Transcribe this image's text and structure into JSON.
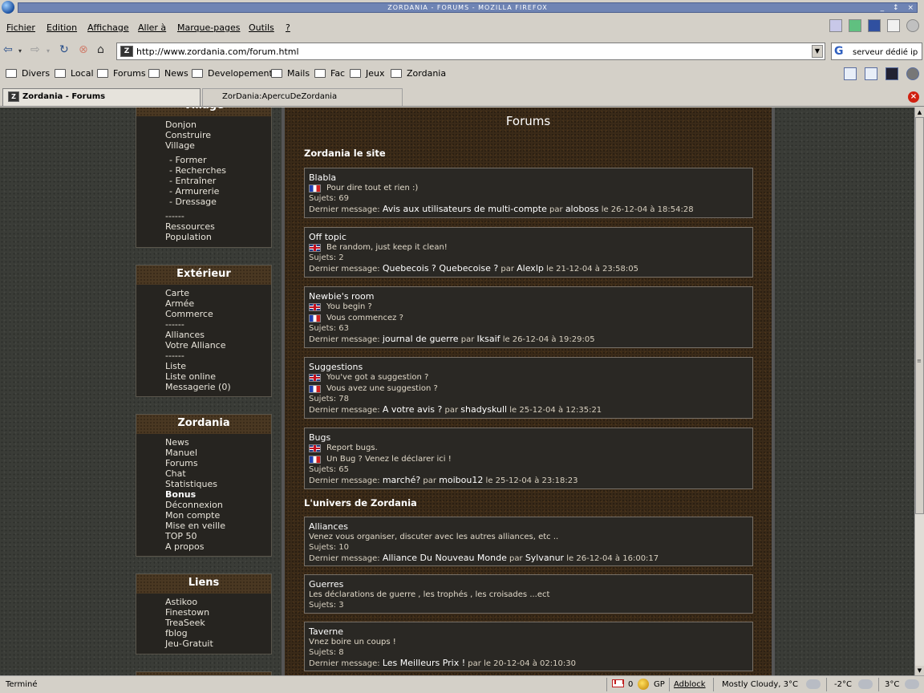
{
  "window": {
    "title": "ZORDANIA - FORUMS - MOZILLA FIREFOX",
    "controls": [
      "_",
      "↕",
      "×"
    ]
  },
  "menubar": {
    "items": [
      "Fichier",
      "Edition",
      "Affichage",
      "Aller à",
      "Marque-pages",
      "Outils",
      "?"
    ]
  },
  "nav": {
    "url": "http://www.zordania.com/forum.html",
    "search_value": "serveur dédié ip"
  },
  "bookmarks": {
    "items": [
      "Divers",
      "Local",
      "Forums",
      "News",
      "Developement",
      "Mails",
      "Fac",
      "Jeux",
      "Zordania"
    ]
  },
  "tabs": [
    {
      "label": "Zordania - Forums",
      "active": true
    },
    {
      "label": "ZorDania:ApercuDeZordania",
      "active": false
    }
  ],
  "sidebar": {
    "village": {
      "title": "Village",
      "items": [
        "Donjon",
        "Construire",
        "Village"
      ],
      "subitems": [
        "- Former",
        "- Recherches",
        "- Entraîner",
        "- Armurerie",
        "- Dressage"
      ],
      "separator": "------",
      "items2": [
        "Ressources",
        "Population"
      ]
    },
    "exterieur": {
      "title": "Extérieur",
      "items": [
        "Carte",
        "Armée",
        "Commerce",
        "------",
        "Alliances",
        "Votre Alliance",
        "------",
        "Liste",
        "Liste online",
        "Messagerie (0)"
      ]
    },
    "zordania": {
      "title": "Zordania",
      "items": [
        "News",
        "Manuel",
        "Forums",
        "Chat",
        "Statistiques",
        "Bonus",
        "Déconnexion",
        "Mon compte",
        "Mise en veille",
        "TOP 50",
        "A propos"
      ]
    },
    "liens": {
      "title": "Liens",
      "items": [
        "Astikoo",
        "Finestown",
        "TreaSeek",
        "fblog",
        "Jeu-Gratuit"
      ]
    }
  },
  "main": {
    "title": "Forums",
    "section1": "Zordania le site",
    "section2": "L'univers de Zordania",
    "forums": [
      {
        "name": "Blabla",
        "descs": [
          {
            "flag": "fr",
            "text": "Pour dire tout et rien :)"
          }
        ],
        "count": "Sujets: 69",
        "last_prefix": "Dernier message: ",
        "last_title": "Avis aux utilisateurs de multi-compte",
        "last_suffix": " par ",
        "last_user": "aloboss",
        "last_date": " le 26-12-04 à 18:54:28"
      },
      {
        "name": "Off topic",
        "descs": [
          {
            "flag": "uk",
            "text": "Be random, just keep it clean!"
          }
        ],
        "count": "Sujets: 2",
        "last_prefix": "Dernier message: ",
        "last_title": "Quebecois ? Quebecoise ?",
        "last_suffix": " par ",
        "last_user": "Alexlp",
        "last_date": " le 21-12-04 à 23:58:05"
      },
      {
        "name": "Newbie's room",
        "descs": [
          {
            "flag": "uk",
            "text": "You begin ?"
          },
          {
            "flag": "fr",
            "text": "Vous commencez ?"
          }
        ],
        "count": "Sujets: 63",
        "last_prefix": "Dernier message: ",
        "last_title": "journal de guerre",
        "last_suffix": " par ",
        "last_user": "Iksaif",
        "last_date": " le 26-12-04 à 19:29:05"
      },
      {
        "name": "Suggestions",
        "descs": [
          {
            "flag": "uk",
            "text": "You've got a suggestion ?"
          },
          {
            "flag": "fr",
            "text": "Vous avez une suggestion ?"
          }
        ],
        "count": "Sujets: 78",
        "last_prefix": "Dernier message: ",
        "last_title": "A votre avis ?",
        "last_suffix": " par ",
        "last_user": "shadyskull",
        "last_date": " le 25-12-04 à 12:35:21"
      },
      {
        "name": "Bugs",
        "descs": [
          {
            "flag": "uk",
            "text": "Report bugs."
          },
          {
            "flag": "fr",
            "text": "Un Bug ? Venez le déclarer ici !"
          }
        ],
        "count": "Sujets: 65",
        "last_prefix": "Dernier message: ",
        "last_title": "marché?",
        "last_suffix": " par ",
        "last_user": "moibou12",
        "last_date": " le 25-12-04 à 23:18:23"
      },
      {
        "name": "Alliances",
        "descs": [
          {
            "flag": "",
            "text": "Venez vous organiser, discuter avec les autres alliances, etc .."
          }
        ],
        "count": "Sujets: 10",
        "last_prefix": "Dernier message: ",
        "last_title": "Alliance Du Nouveau Monde",
        "last_suffix": " par ",
        "last_user": "Sylvanur",
        "last_date": " le 26-12-04 à 16:00:17"
      },
      {
        "name": "Guerres",
        "descs": [
          {
            "flag": "",
            "text": "Les déclarations de guerre , les trophés , les croisades ...ect"
          }
        ],
        "count": "Sujets: 3",
        "last_prefix": "",
        "last_title": "",
        "last_suffix": "",
        "last_user": "",
        "last_date": ""
      },
      {
        "name": "Taverne",
        "descs": [
          {
            "flag": "",
            "text": "Vnez boire un coups !"
          }
        ],
        "count": "Sujets: 8",
        "last_prefix": "Dernier message: ",
        "last_title": "Les Meilleurs Prix !",
        "last_suffix": " par le 20-12-04 à 02:10:30",
        "last_user": "",
        "last_date": ""
      }
    ]
  },
  "statusbar": {
    "status": "Terminé",
    "mail_count": "0",
    "gp": "GP",
    "adblock": "Adblock",
    "weather1": "Mostly Cloudy, 3°C",
    "weather2": "-2°C",
    "weather3": "3°C"
  }
}
